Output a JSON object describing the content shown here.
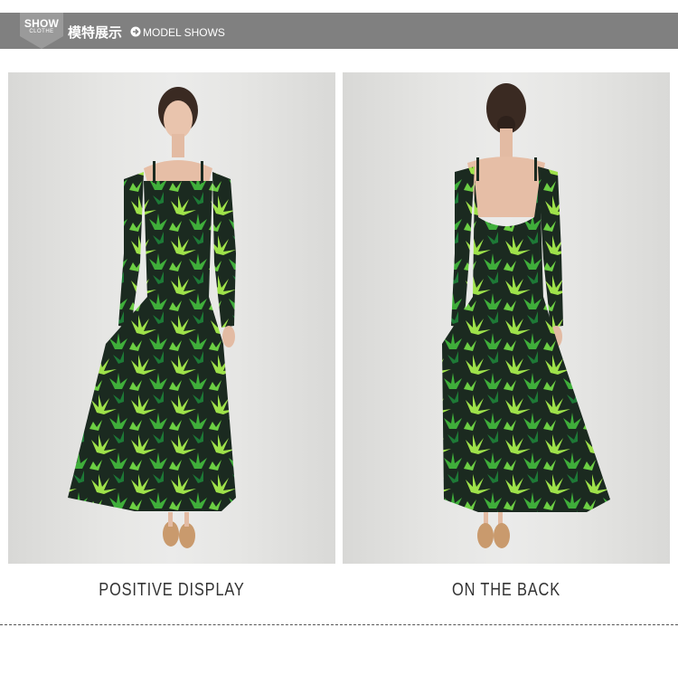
{
  "header": {
    "badge_title": "SHOW",
    "badge_subtitle": "CLOTHE",
    "title_cn": "模特展示",
    "title_en": "MODEL SHOWS",
    "arrow_icon": "right-arrow-circle-icon",
    "bar_color": "#808080"
  },
  "photos": [
    {
      "caption": "POSITIVE DISPLAY",
      "view": "front"
    },
    {
      "caption": "ON THE BACK",
      "view": "back"
    }
  ],
  "dress": {
    "base_color": "#1b2a20",
    "leaf_color_light": "#9ee24a",
    "leaf_color_mid": "#3fae3a",
    "leaf_color_dark": "#1d7a36"
  }
}
